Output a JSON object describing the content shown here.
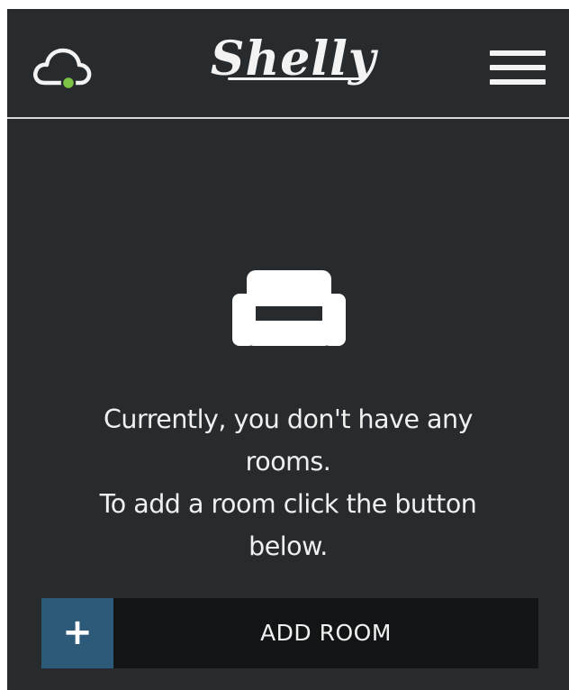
{
  "header": {
    "logo_text": "Shelly",
    "cloud_icon": "cloud-connected-icon",
    "cloud_status_color": "#7cc244",
    "menu_icon": "hamburger-menu-icon"
  },
  "empty_state": {
    "icon": "sofa-icon",
    "message_lines": [
      "Currently, you don't have any",
      "rooms.",
      "To add a room click the button",
      "below."
    ]
  },
  "add_room_button": {
    "icon": "plus-icon",
    "plus": "+",
    "label": "ADD ROOM"
  },
  "colors": {
    "background": "#272b2e",
    "foreground": "#f0f0f0",
    "button_background": "#121516",
    "button_accent": "#2d5a78"
  }
}
